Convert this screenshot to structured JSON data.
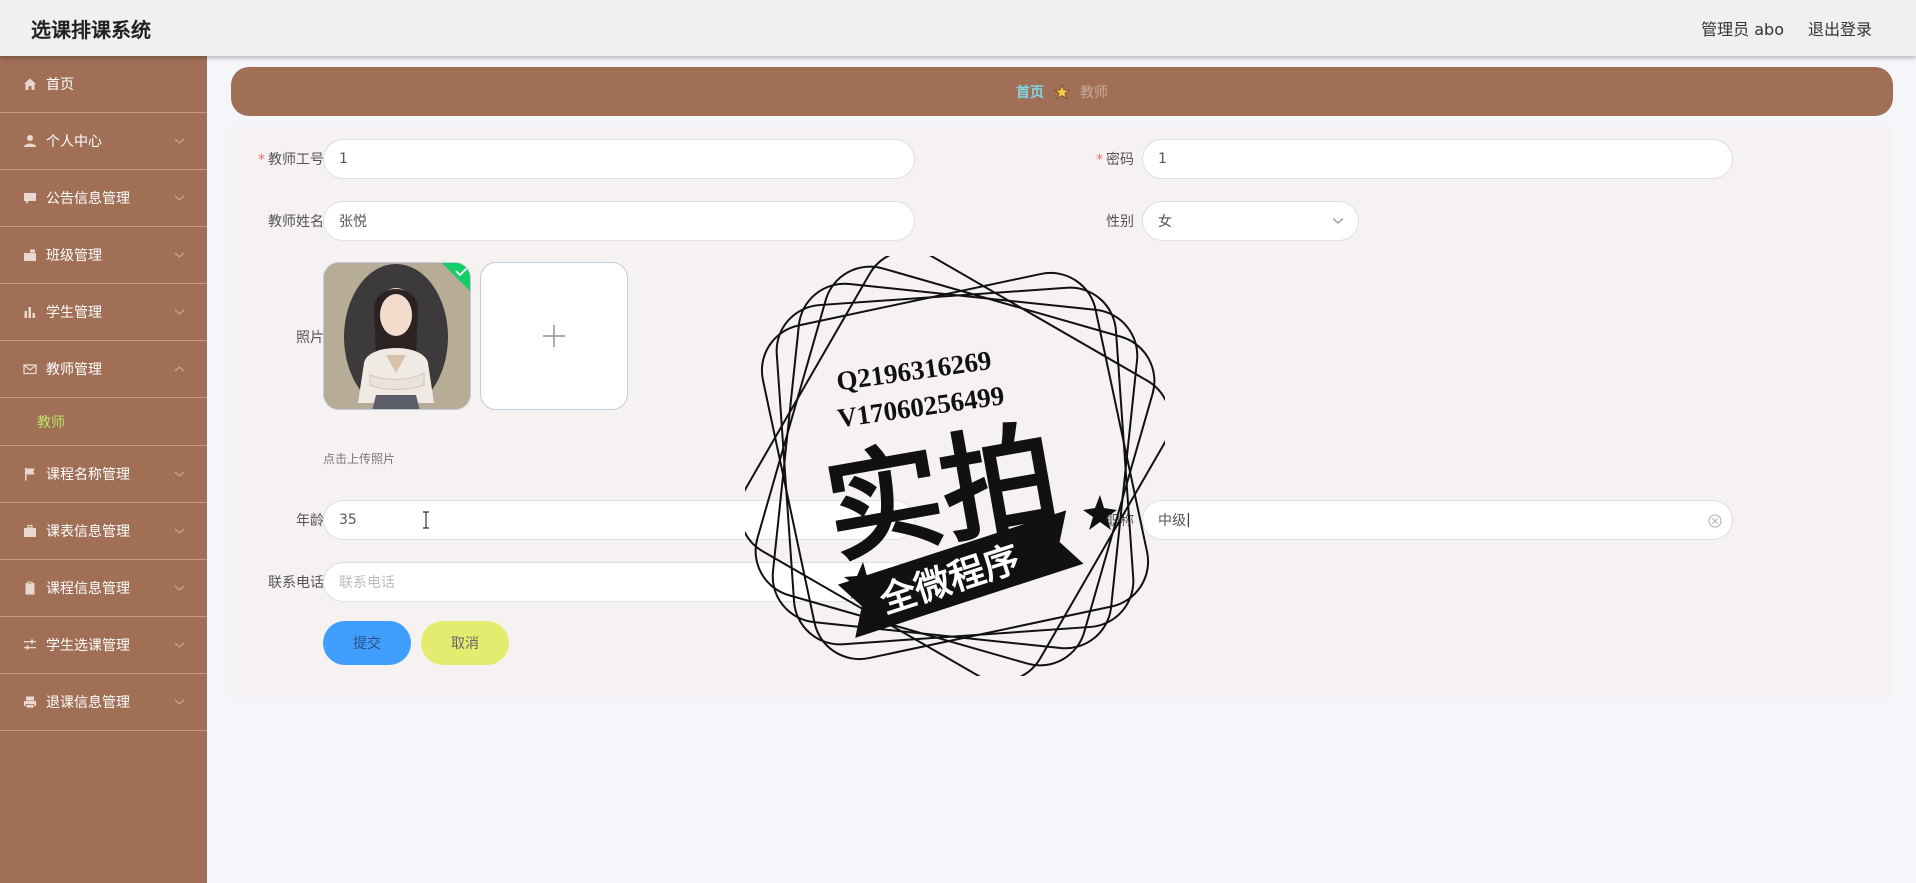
{
  "header": {
    "app_title": "选课排课系统",
    "user_label": "管理员 abo",
    "logout_label": "退出登录"
  },
  "sidebar": {
    "items": [
      {
        "label": "首页",
        "icon": "home-icon"
      },
      {
        "label": "个人中心",
        "icon": "user-icon"
      },
      {
        "label": "公告信息管理",
        "icon": "message-icon"
      },
      {
        "label": "班级管理",
        "icon": "briefcase-icon"
      },
      {
        "label": "学生管理",
        "icon": "bar-chart-icon"
      },
      {
        "label": "教师管理",
        "icon": "mail-icon",
        "expanded": true,
        "children": [
          {
            "label": "教师",
            "active": true
          }
        ]
      },
      {
        "label": "课程名称管理",
        "icon": "flag-icon"
      },
      {
        "label": "课表信息管理",
        "icon": "suitcase-icon"
      },
      {
        "label": "课程信息管理",
        "icon": "clipboard-icon"
      },
      {
        "label": "学生选课管理",
        "icon": "sliders-icon"
      },
      {
        "label": "退课信息管理",
        "icon": "printer-icon"
      }
    ],
    "colors": {
      "background": "#a06f56",
      "active_text": "#b9e36a"
    }
  },
  "breadcrumb": {
    "home": "首页",
    "current": "教师"
  },
  "form": {
    "teacher_no": {
      "label": "教师工号",
      "value": "1",
      "required": true
    },
    "password": {
      "label": "密码",
      "value": "1",
      "required": true
    },
    "teacher_name": {
      "label": "教师姓名",
      "value": "张悦"
    },
    "gender": {
      "label": "性别",
      "value": "女"
    },
    "photo": {
      "label": "照片",
      "tip": "点击上传照片"
    },
    "age": {
      "label": "年龄",
      "value": "35"
    },
    "title": {
      "label": "职称",
      "value": "中级"
    },
    "phone": {
      "label": "联系电话",
      "value": "",
      "placeholder": "联系电话"
    }
  },
  "buttons": {
    "submit": "提交",
    "cancel": "取消"
  },
  "watermark": {
    "line1": "Q2196316269",
    "line2": "V17060256499",
    "main": "实拍",
    "banner": "全微程序"
  }
}
